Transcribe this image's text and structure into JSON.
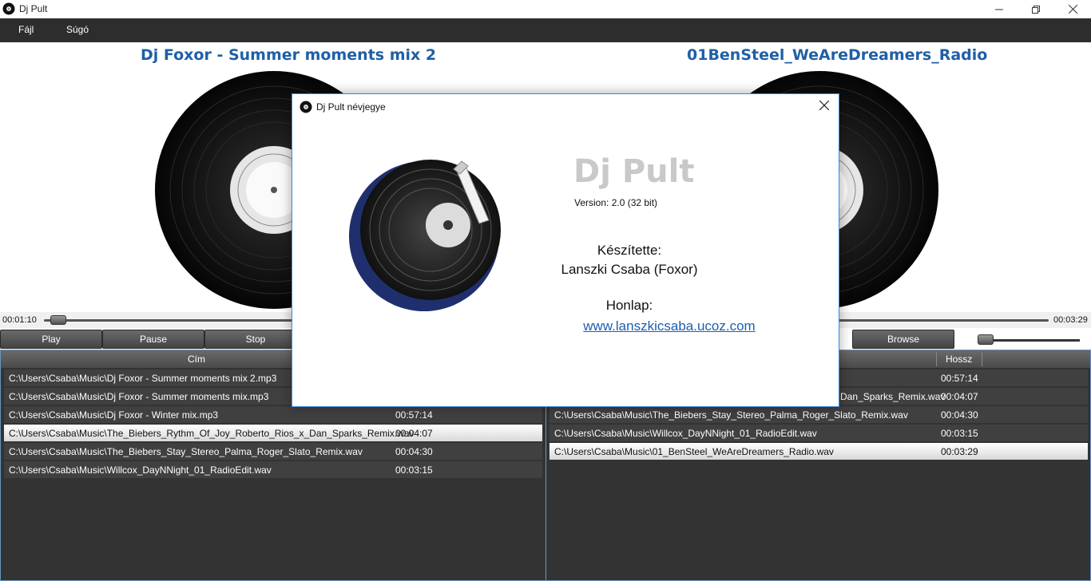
{
  "window": {
    "title": "Dj Pult",
    "minimize_icon": "minimize-icon",
    "maximize_icon": "restore-icon",
    "close_icon": "close-icon"
  },
  "menu": {
    "file": "Fájl",
    "help": "Súgó"
  },
  "decks": {
    "left": {
      "title": "Dj Foxor - Summer moments mix 2",
      "time": "00:01:10",
      "position_fraction": 0.02
    },
    "right": {
      "title": "01BenSteel_WeAreDreamers_Radio",
      "time": "00:03:29",
      "position_fraction": 0.0
    }
  },
  "transport": {
    "play": "Play",
    "pause": "Pause",
    "stop": "Stop",
    "browse": "Browse"
  },
  "playlist_left": {
    "columns": [
      "Cím",
      ""
    ],
    "rows": [
      {
        "path": "C:\\Users\\Csaba\\Music\\Dj Foxor - Summer moments mix 2.mp3",
        "length": ""
      },
      {
        "path": "C:\\Users\\Csaba\\Music\\Dj Foxor - Summer moments mix.mp3",
        "length": ""
      },
      {
        "path": "C:\\Users\\Csaba\\Music\\Dj Foxor - Winter mix.mp3",
        "length": "00:57:14"
      },
      {
        "path": "C:\\Users\\Csaba\\Music\\The_Biebers_Rythm_Of_Joy_Roberto_Rios_x_Dan_Sparks_Remix.wav",
        "length": "00:04:07",
        "selected": true
      },
      {
        "path": "C:\\Users\\Csaba\\Music\\The_Biebers_Stay_Stereo_Palma_Roger_Slato_Remix.wav",
        "length": "00:04:30"
      },
      {
        "path": "C:\\Users\\Csaba\\Music\\Willcox_DayNNight_01_RadioEdit.wav",
        "length": "00:03:15"
      }
    ]
  },
  "playlist_right": {
    "columns": [
      "",
      "Hossz"
    ],
    "rows": [
      {
        "path": "",
        "length": "00:57:14"
      },
      {
        "path": "Dan_Sparks_Remix.wav",
        "length": "00:04:07"
      },
      {
        "path": "C:\\Users\\Csaba\\Music\\The_Biebers_Stay_Stereo_Palma_Roger_Slato_Remix.wav",
        "length": "00:04:30"
      },
      {
        "path": "C:\\Users\\Csaba\\Music\\Willcox_DayNNight_01_RadioEdit.wav",
        "length": "00:03:15"
      },
      {
        "path": "C:\\Users\\Csaba\\Music\\01_BenSteel_WeAreDreamers_Radio.wav",
        "length": "00:03:29",
        "selected": true
      }
    ]
  },
  "about": {
    "title": "Dj Pult névjegye",
    "app_name": "Dj Pult",
    "version": "Version: 2.0 (32 bit)",
    "made_by_label": "Készítette:",
    "author": "Lanszki Csaba (Foxor)",
    "homepage_label": "Honlap:",
    "homepage_link": "www.lanszkicsaba.ucoz.com"
  }
}
